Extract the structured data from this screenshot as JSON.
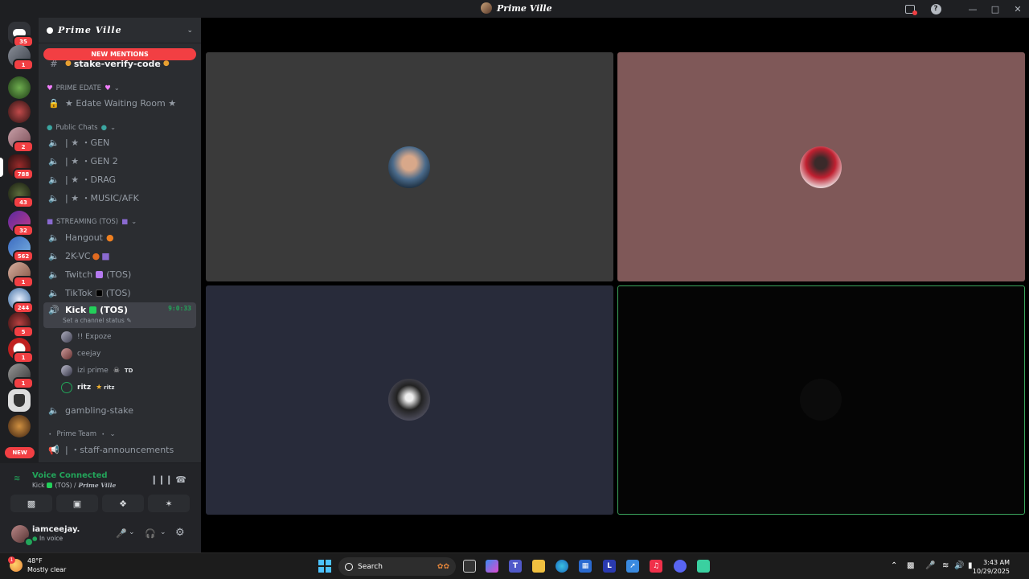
{
  "window": {
    "title": "Prime Ville"
  },
  "rail": {
    "servers": [
      {
        "badge": "35"
      },
      {
        "badge": "1"
      },
      {
        "badge": ""
      },
      {
        "badge": ""
      },
      {
        "badge": "2"
      },
      {
        "badge": "788"
      },
      {
        "badge": "43"
      },
      {
        "badge": "32"
      },
      {
        "badge": "562"
      },
      {
        "badge": "1"
      },
      {
        "badge": "244"
      },
      {
        "badge": "5"
      },
      {
        "badge": "1"
      },
      {
        "badge": "1"
      },
      {
        "badge": ""
      },
      {
        "badge": ""
      }
    ],
    "new_label": "NEW"
  },
  "server": {
    "name": "Prime Ville",
    "new_mentions": "NEW MENTIONS"
  },
  "channels": {
    "verify": "stake-verify-code",
    "cat_edate": "PRIME EDATE",
    "edate_room": "★ Edate Waiting Room ★",
    "cat_public": "Public Chats",
    "gen": "|  ★ ・GEN",
    "gen2": "|  ★ ・GEN 2",
    "drag": "|  ★ ・DRAG",
    "music": "|  ★ ・MUSIC/AFK",
    "cat_streaming": "STREAMING (TOS)",
    "hangout": "Hangout",
    "vc2k": "2K-VC",
    "twitch_a": "Twitch",
    "twitch_b": "(TOS)",
    "tiktok_a": "TikTok",
    "tiktok_b": "(TOS)",
    "kick_a": "Kick",
    "kick_b": "(TOS)",
    "kick_timer": "9:0:33",
    "kick_status": "Set a channel status",
    "gambling": "gambling-stake",
    "cat_team": "Prime Team",
    "staff": "|  ・staff-announcements"
  },
  "voice_users": [
    {
      "name": "!! Expoze",
      "tag": ""
    },
    {
      "name": "ceejay",
      "tag": ""
    },
    {
      "name": "izi prime",
      "tag": "TD"
    },
    {
      "name": "ritz",
      "tag": "ritz"
    }
  ],
  "voice": {
    "connected": "Voice Connected",
    "channel_a": "Kick",
    "channel_b": "(TOS) /",
    "server": "Prime Ville"
  },
  "user": {
    "name": "iamceejay.",
    "status": "In voice"
  },
  "taskbar": {
    "temp": "48°F",
    "condition": "Mostly clear",
    "weather_badge": "1",
    "search": "Search",
    "time": "3:43 AM",
    "date": "10/29/2025"
  },
  "colors": {
    "accent_green": "#23a55a",
    "mention_red": "#f23f43",
    "tile1": "#3a3a3a",
    "tile2": "#7f5858",
    "tile3": "#282b3a",
    "tile4": "#050505"
  }
}
